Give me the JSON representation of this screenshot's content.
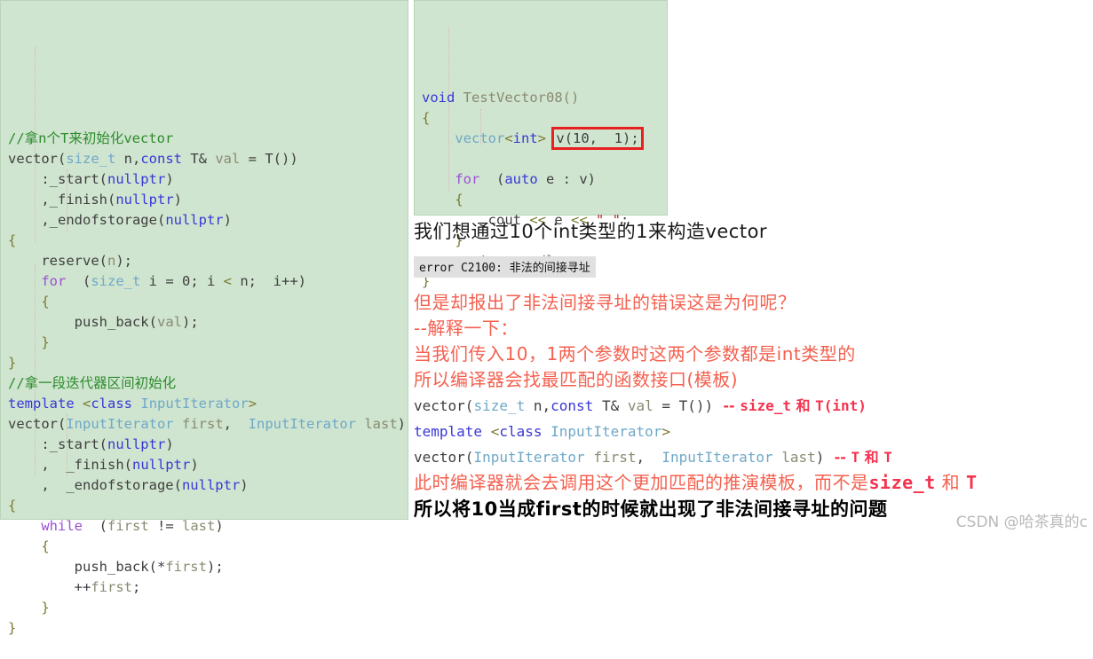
{
  "left_code": {
    "panel_bg": "#cfe5cf",
    "lines": [
      [
        {
          "t": "//拿n个T来初始化vector",
          "c": "comment"
        }
      ],
      [
        {
          "t": "vector(",
          "c": "plain"
        },
        {
          "t": "size_t",
          "c": "type"
        },
        {
          "t": " n,",
          "c": "plain"
        },
        {
          "t": "const",
          "c": "kw"
        },
        {
          "t": " T& ",
          "c": "plain"
        },
        {
          "t": "val",
          "c": "ident"
        },
        {
          "t": " = T())",
          "c": "plain"
        }
      ],
      [
        {
          "t": "    :_start(",
          "c": "plain"
        },
        {
          "t": "nullptr",
          "c": "kw"
        },
        {
          "t": ")",
          "c": "plain"
        }
      ],
      [
        {
          "t": "    ,_finish(",
          "c": "plain"
        },
        {
          "t": "nullptr",
          "c": "kw"
        },
        {
          "t": ")",
          "c": "plain"
        }
      ],
      [
        {
          "t": "    ,_endofstorage(",
          "c": "plain"
        },
        {
          "t": "nullptr",
          "c": "kw"
        },
        {
          "t": ")",
          "c": "plain"
        }
      ],
      [
        {
          "t": "{",
          "c": "brace"
        }
      ],
      [
        {
          "t": "    reserve(",
          "c": "plain"
        },
        {
          "t": "n",
          "c": "ident"
        },
        {
          "t": ");",
          "c": "plain"
        }
      ],
      [
        {
          "t": "    ",
          "c": "plain"
        },
        {
          "t": "for",
          "c": "kw2"
        },
        {
          "t": "  (",
          "c": "plain"
        },
        {
          "t": "size_t",
          "c": "type"
        },
        {
          "t": " i = 0; i ",
          "c": "plain"
        },
        {
          "t": "<",
          "c": "angle"
        },
        {
          "t": " n;  i++)",
          "c": "plain"
        }
      ],
      [
        {
          "t": "    {",
          "c": "brace"
        }
      ],
      [
        {
          "t": "        push_back(",
          "c": "plain"
        },
        {
          "t": "val",
          "c": "ident"
        },
        {
          "t": ");",
          "c": "plain"
        }
      ],
      [
        {
          "t": "    }",
          "c": "brace"
        }
      ],
      [
        {
          "t": "}",
          "c": "brace"
        }
      ],
      [
        {
          "t": "//拿一段迭代器区间初始化",
          "c": "comment"
        }
      ],
      [
        {
          "t": "template",
          "c": "kw"
        },
        {
          "t": " ",
          "c": "plain"
        },
        {
          "t": "<",
          "c": "angle"
        },
        {
          "t": "class",
          "c": "kw"
        },
        {
          "t": " ",
          "c": "plain"
        },
        {
          "t": "InputIterator",
          "c": "type"
        },
        {
          "t": ">",
          "c": "angle"
        }
      ],
      [
        {
          "t": "vector(",
          "c": "plain"
        },
        {
          "t": "InputIterator",
          "c": "type"
        },
        {
          "t": " ",
          "c": "plain"
        },
        {
          "t": "first",
          "c": "ident"
        },
        {
          "t": ",  ",
          "c": "plain"
        },
        {
          "t": "InputIterator",
          "c": "type"
        },
        {
          "t": " ",
          "c": "plain"
        },
        {
          "t": "last",
          "c": "ident"
        },
        {
          "t": ")",
          "c": "plain"
        }
      ],
      [
        {
          "t": "    :_start(",
          "c": "plain"
        },
        {
          "t": "nullptr",
          "c": "kw"
        },
        {
          "t": ")",
          "c": "plain"
        }
      ],
      [
        {
          "t": "    ,  _finish(",
          "c": "plain"
        },
        {
          "t": "nullptr",
          "c": "kw"
        },
        {
          "t": ")",
          "c": "plain"
        }
      ],
      [
        {
          "t": "    ,  _endofstorage(",
          "c": "plain"
        },
        {
          "t": "nullptr",
          "c": "kw"
        },
        {
          "t": ")",
          "c": "plain"
        }
      ],
      [
        {
          "t": "{",
          "c": "brace"
        }
      ],
      [
        {
          "t": "    ",
          "c": "plain"
        },
        {
          "t": "while",
          "c": "kw2"
        },
        {
          "t": "  (",
          "c": "plain"
        },
        {
          "t": "first",
          "c": "ident"
        },
        {
          "t": " != ",
          "c": "plain"
        },
        {
          "t": "last",
          "c": "ident"
        },
        {
          "t": ")",
          "c": "plain"
        }
      ],
      [
        {
          "t": "    {",
          "c": "brace"
        }
      ],
      [
        {
          "t": "        push_back(*",
          "c": "plain"
        },
        {
          "t": "first",
          "c": "ident"
        },
        {
          "t": ");",
          "c": "plain"
        }
      ],
      [
        {
          "t": "        ++",
          "c": "plain"
        },
        {
          "t": "first",
          "c": "ident"
        },
        {
          "t": ";",
          "c": "plain"
        }
      ],
      [
        {
          "t": "    }",
          "c": "brace"
        }
      ],
      [
        {
          "t": "}",
          "c": "brace"
        }
      ]
    ]
  },
  "right_code": {
    "panel_bg": "#cfe5cf",
    "highlight_color": "#e82020",
    "highlight_text": "v(10,  1);",
    "lines": [
      [
        {
          "t": "void",
          "c": "kw"
        },
        {
          "t": " ",
          "c": "plain"
        },
        {
          "t": "TestVector08()",
          "c": "ident"
        }
      ],
      [
        {
          "t": "{",
          "c": "brace"
        }
      ],
      [
        {
          "t": "    ",
          "c": "plain"
        },
        {
          "t": "vector",
          "c": "type"
        },
        {
          "t": "<",
          "c": "angle"
        },
        {
          "t": "int",
          "c": "kw"
        },
        {
          "t": ">",
          "c": "angle"
        },
        {
          "t": " ",
          "c": "plain"
        },
        {
          "t": "v(10,  1);",
          "c": "hl"
        }
      ],
      [
        {
          "t": "",
          "c": "plain"
        }
      ],
      [
        {
          "t": "    ",
          "c": "plain"
        },
        {
          "t": "for",
          "c": "kw2"
        },
        {
          "t": "  (",
          "c": "plain"
        },
        {
          "t": "auto",
          "c": "kw"
        },
        {
          "t": " e : v)",
          "c": "plain"
        }
      ],
      [
        {
          "t": "    {",
          "c": "brace"
        }
      ],
      [
        {
          "t": "        cout ",
          "c": "plain"
        },
        {
          "t": "<<",
          "c": "angle"
        },
        {
          "t": " e ",
          "c": "plain"
        },
        {
          "t": "<<",
          "c": "angle"
        },
        {
          "t": " ",
          "c": "plain"
        },
        {
          "t": "\" \"",
          "c": "str"
        },
        {
          "t": ";",
          "c": "plain"
        }
      ],
      [
        {
          "t": "    }",
          "c": "brace"
        }
      ],
      [
        {
          "t": "    cout ",
          "c": "plain"
        },
        {
          "t": "<<",
          "c": "angle"
        },
        {
          "t": " ",
          "c": "plain"
        },
        {
          "t": "endl",
          "c": "ident"
        },
        {
          "t": ";",
          "c": "plain"
        }
      ],
      [
        {
          "t": "}",
          "c": "brace"
        }
      ]
    ]
  },
  "prose": {
    "intro_line": "我们想通过10个int类型的1来构造vector",
    "error_badge": "error C2100: 非法的间接寻址",
    "red_line_1": "但是却报出了非法间接寻址的错误这是为何呢？",
    "red_line_2": "--解释一下：",
    "red_line_3": "当我们传入10，1两个参数时这两个参数都是int类型的",
    "red_line_4": "所以编译器会找最匹配的函数接口(模板)",
    "sig_1": [
      {
        "t": "vector(",
        "c": "plain"
      },
      {
        "t": "size_t",
        "c": "type"
      },
      {
        "t": " n,",
        "c": "plain"
      },
      {
        "t": "const",
        "c": "kw"
      },
      {
        "t": " T& ",
        "c": "plain"
      },
      {
        "t": "val",
        "c": "ident"
      },
      {
        "t": " = T())",
        "c": "plain"
      },
      {
        "t": "  -- ",
        "c": "redbold"
      },
      {
        "t": "size_t",
        "c": "redmono"
      },
      {
        "t": " 和 ",
        "c": "redbold"
      },
      {
        "t": "T(int)",
        "c": "redmono"
      }
    ],
    "sig_2": [
      {
        "t": "template",
        "c": "kw"
      },
      {
        "t": " ",
        "c": "plain"
      },
      {
        "t": "<",
        "c": "angle"
      },
      {
        "t": "class",
        "c": "kw"
      },
      {
        "t": " ",
        "c": "plain"
      },
      {
        "t": "InputIterator",
        "c": "type"
      },
      {
        "t": ">",
        "c": "angle"
      }
    ],
    "sig_3": [
      {
        "t": "vector(",
        "c": "plain"
      },
      {
        "t": "InputIterator",
        "c": "type"
      },
      {
        "t": " ",
        "c": "plain"
      },
      {
        "t": "first",
        "c": "ident"
      },
      {
        "t": ",  ",
        "c": "plain"
      },
      {
        "t": "InputIterator",
        "c": "type"
      },
      {
        "t": " ",
        "c": "plain"
      },
      {
        "t": "last",
        "c": "ident"
      },
      {
        "t": ")",
        "c": "plain"
      },
      {
        "t": "  -- ",
        "c": "redbold"
      },
      {
        "t": "T",
        "c": "redmono"
      },
      {
        "t": " 和 ",
        "c": "redbold"
      },
      {
        "t": "T",
        "c": "redmono"
      }
    ],
    "red_line_5_a": "此时编译器就会去调用这个更加匹配的推演模板，而不是",
    "red_line_5_b": "size_t",
    "red_line_5_c": " 和 ",
    "red_line_5_d": "T",
    "final_line": "所以将10当成first的时候就出现了非法间接寻址的问题"
  },
  "watermark": {
    "text": "CSDN @哈茶真的c",
    "color": "#b9b9b9"
  }
}
